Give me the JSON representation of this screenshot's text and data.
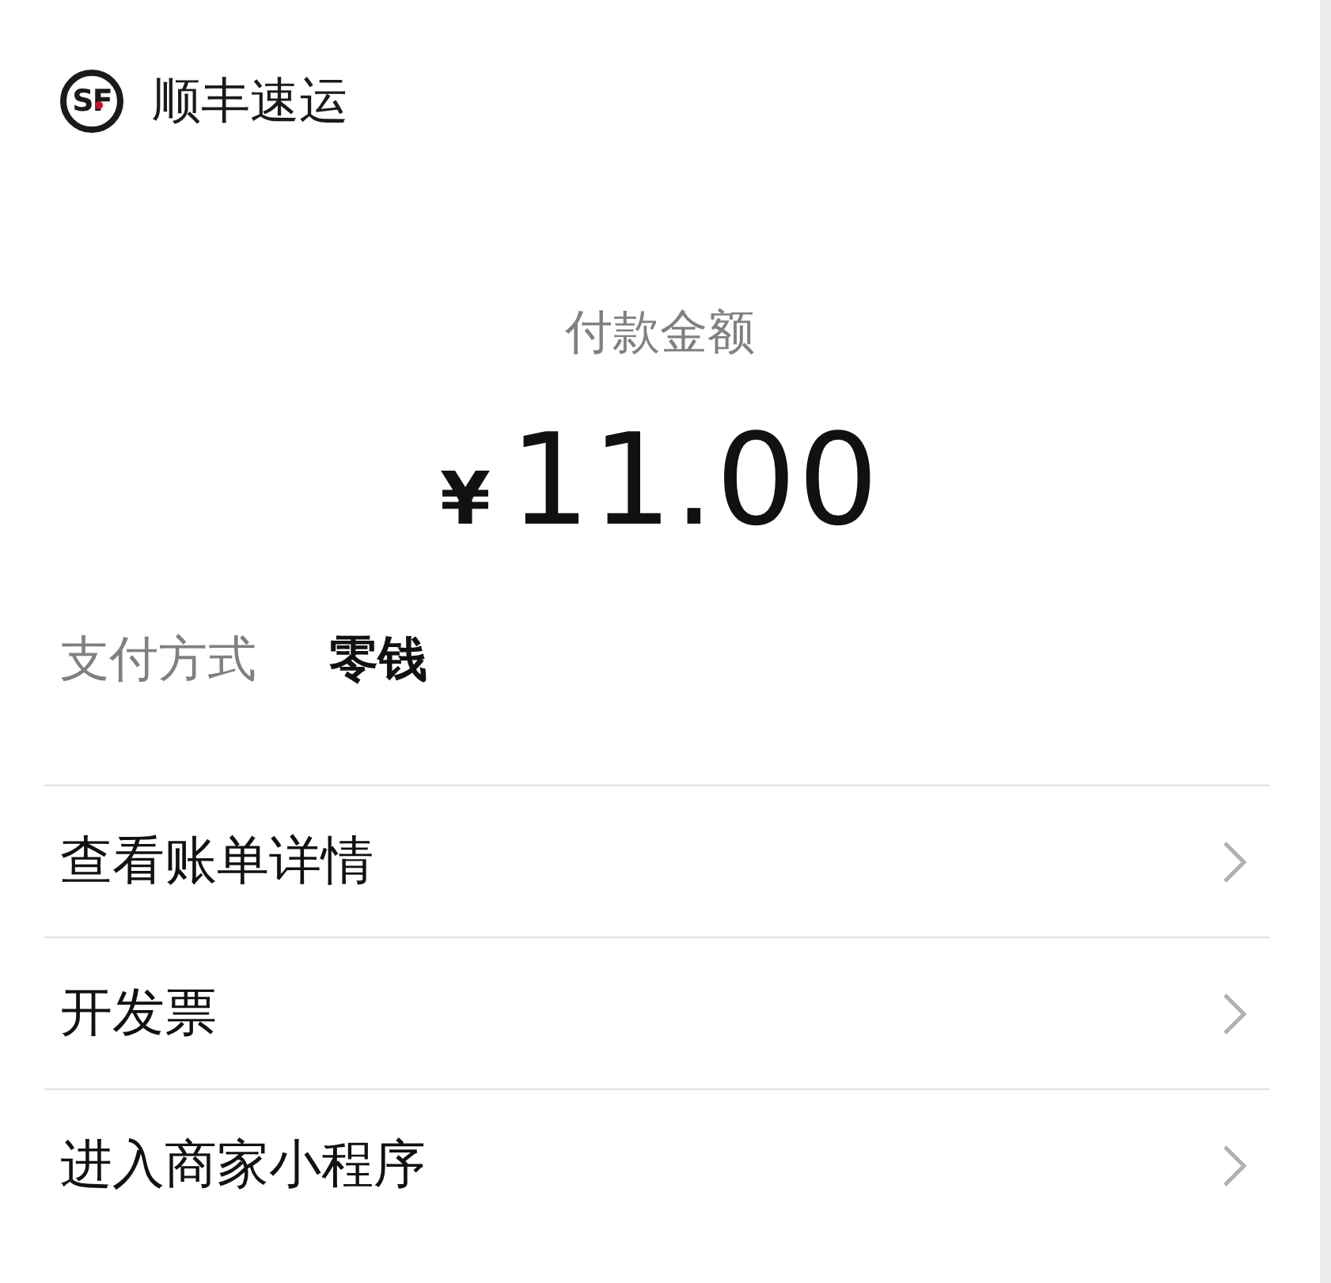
{
  "merchant": {
    "logo_text": "SF",
    "name": "顺丰速运"
  },
  "payment": {
    "label": "付款金额",
    "currency": "¥",
    "amount": "11.00"
  },
  "method": {
    "label": "支付方式",
    "value": "零钱"
  },
  "actions": [
    {
      "label": "查看账单详情"
    },
    {
      "label": "开发票"
    },
    {
      "label": "进入商家小程序"
    }
  ]
}
